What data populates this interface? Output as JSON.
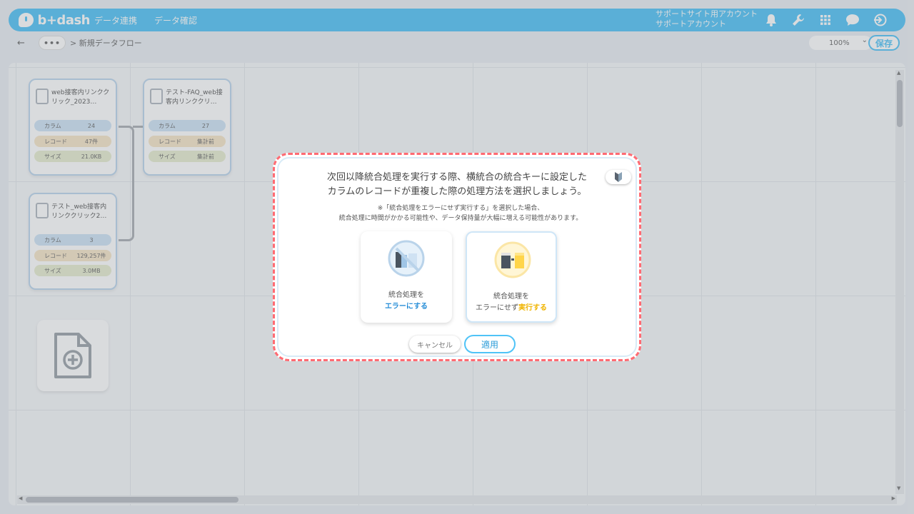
{
  "header": {
    "logo": "b+dash",
    "nav": [
      "データ連携",
      "データ確認"
    ],
    "account_line1": "サポートサイト用アカウント",
    "account_line2": "サポートアカウント",
    "icons": [
      "bell-icon",
      "wrench-icon",
      "grid-icon",
      "chat-icon",
      "logout-icon"
    ]
  },
  "subbar": {
    "more": "•••",
    "breadcrumb": "> 新規データフロー",
    "zoom": "100%",
    "save": "保存"
  },
  "nodes": [
    {
      "title": "web接客内リンククリック_2023…",
      "column_label": "カラム",
      "columns": "24",
      "record_label": "レコード",
      "records": "47件",
      "size_label": "サイズ",
      "size": "21.0KB"
    },
    {
      "title": "テスト-FAQ_web接客内リンククリ…",
      "column_label": "カラム",
      "columns": "27",
      "record_label": "レコード",
      "records": "集計前",
      "size_label": "サイズ",
      "size": "集計前"
    },
    {
      "title": "テスト_web接客内リンククリック2…",
      "column_label": "カラム",
      "columns": "3",
      "record_label": "レコード",
      "records": "129,257件",
      "size_label": "サイズ",
      "size": "3.0MB"
    }
  ],
  "modal": {
    "title_line1": "次回以降統合処理を実行する際、横統合の統合キーに設定した",
    "title_line2": "カラムのレコードが重複した際の処理方法を選択しましょう。",
    "note_line1": "※「統合処理をエラーにせず実行する」を選択した場合、",
    "note_line2": "統合処理に時間がかかる可能性や、データ保持量が大幅に増える可能性があります。",
    "option1": {
      "line1": "統合処理を",
      "line2": "エラーにする"
    },
    "option2": {
      "line1": "統合処理を",
      "line2_prefix": "エラーにせず",
      "line2_accent": "実行する"
    },
    "cancel": "キャンセル",
    "apply": "適用"
  },
  "colors": {
    "brand": "#4fc3f7",
    "dialog_border": "#ff6b73",
    "accent_yellow": "#f0b400",
    "accent_blue": "#2a8fd8"
  }
}
